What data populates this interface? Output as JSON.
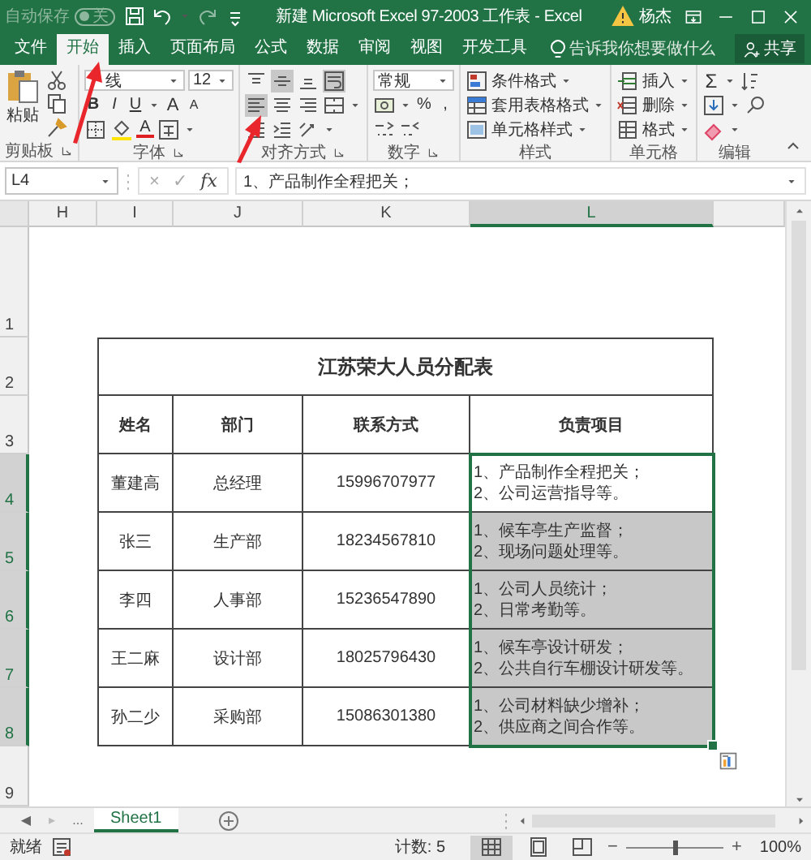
{
  "title_bar": {
    "autosave_label": "自动保存",
    "autosave_state": "关",
    "autosave_on": false,
    "title": "新建 Microsoft Excel 97-2003 工作表  -  Excel",
    "user": "杨杰"
  },
  "tabs": [
    {
      "label": "文件",
      "selected": false
    },
    {
      "label": "开始",
      "selected": true
    },
    {
      "label": "插入",
      "selected": false
    },
    {
      "label": "页面布局",
      "selected": false
    },
    {
      "label": "公式",
      "selected": false
    },
    {
      "label": "数据",
      "selected": false
    },
    {
      "label": "审阅",
      "selected": false
    },
    {
      "label": "视图",
      "selected": false
    },
    {
      "label": "开发工具",
      "selected": false
    }
  ],
  "tell_me": {
    "placeholder": "告诉我你想要做什么"
  },
  "share": "共享",
  "ribbon": {
    "clipboard": {
      "label": "剪贴板",
      "paste": "粘贴"
    },
    "font": {
      "label": "字体",
      "name": "线",
      "size": "12",
      "bold": "B",
      "italic": "I",
      "underline": "U",
      "grow": "A",
      "shrink": "A",
      "font_color_label": "A"
    },
    "alignment": {
      "label": "对齐方式"
    },
    "number": {
      "label": "数字",
      "format": "常规",
      "percent": "%",
      "comma": ","
    },
    "styles": {
      "label": "样式",
      "items": [
        "条件格式",
        "套用表格格式",
        "单元格样式"
      ]
    },
    "cells": {
      "label": "单元格",
      "items": [
        "插入",
        "删除",
        "格式"
      ]
    },
    "editing": {
      "label": "编辑",
      "sum": "Σ"
    }
  },
  "formula_bar": {
    "name_box": "L4",
    "cancel": "×",
    "enter": "✓",
    "fx": "fx",
    "content": "1、产品制作全程把关；"
  },
  "columns": [
    {
      "label": "H",
      "selected": false
    },
    {
      "label": "I",
      "selected": false
    },
    {
      "label": "J",
      "selected": false
    },
    {
      "label": "K",
      "selected": false
    },
    {
      "label": "L",
      "selected": true
    }
  ],
  "rows": [
    {
      "label": "1",
      "selected": false
    },
    {
      "label": "2",
      "selected": false
    },
    {
      "label": "3",
      "selected": false
    },
    {
      "label": "4",
      "selected": true
    },
    {
      "label": "5",
      "selected": true
    },
    {
      "label": "6",
      "selected": true
    },
    {
      "label": "7",
      "selected": true
    },
    {
      "label": "8",
      "selected": true
    },
    {
      "label": "9",
      "selected": false
    }
  ],
  "table": {
    "title": "江苏荣大人员分配表",
    "headers": [
      "姓名",
      "部门",
      "联系方式",
      "负责项目"
    ],
    "rows": [
      {
        "name": "董建高",
        "dept": "总经理",
        "phone": "15996707977",
        "duties": [
          "1、产品制作全程把关；",
          "2、公司运营指导等。"
        ],
        "selected": true,
        "active": true
      },
      {
        "name": "张三",
        "dept": "生产部",
        "phone": "18234567810",
        "duties": [
          "1、候车亭生产监督；",
          "2、现场问题处理等。"
        ],
        "selected": true,
        "active": false
      },
      {
        "name": "李四",
        "dept": "人事部",
        "phone": "15236547890",
        "duties": [
          "1、公司人员统计；",
          "2、日常考勤等。"
        ],
        "selected": true,
        "active": false
      },
      {
        "name": "王二麻",
        "dept": "设计部",
        "phone": "18025796430",
        "duties": [
          "1、候车亭设计研发；",
          "2、公共自行车棚设计研发等。"
        ],
        "selected": true,
        "active": false
      },
      {
        "name": "孙二少",
        "dept": "采购部",
        "phone": "15086301380",
        "duties": [
          "1、公司材料缺少增补；",
          "2、供应商之间合作等。"
        ],
        "selected": true,
        "active": false
      }
    ]
  },
  "sheet_tabs": {
    "prev": "◀",
    "next": "▸",
    "more": "...",
    "tabs": [
      {
        "label": "Sheet1",
        "selected": true
      }
    ]
  },
  "status_bar": {
    "ready": "就绪",
    "count": "计数: 5",
    "zoom_out": "−",
    "zoom_in": "+",
    "zoom": "100%",
    "zoom_slider": {
      "level": 0.5
    }
  }
}
